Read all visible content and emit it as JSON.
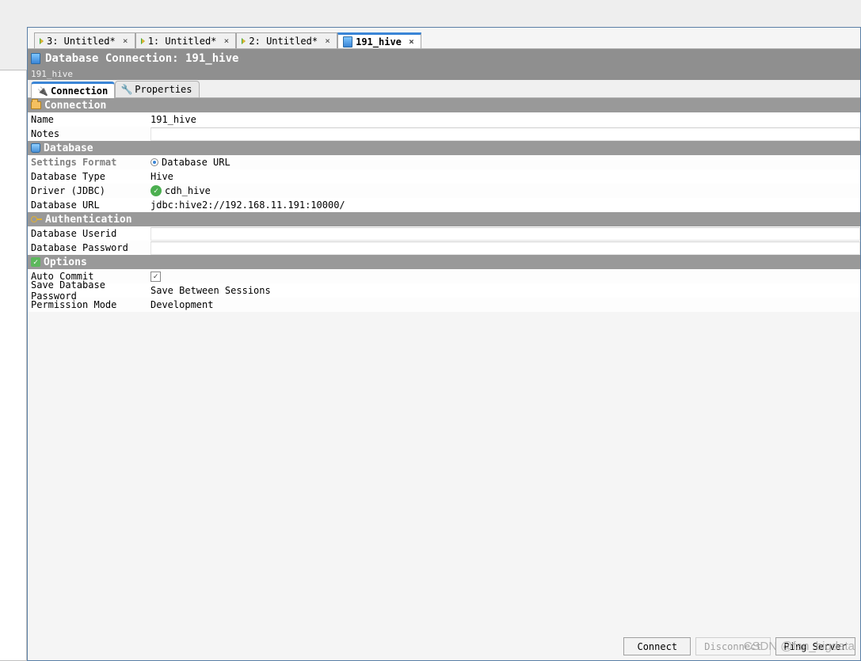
{
  "file_tabs": [
    {
      "label": "3: Untitled*",
      "active": false
    },
    {
      "label": "1: Untitled*",
      "active": false
    },
    {
      "label": "2: Untitled*",
      "active": false
    },
    {
      "label": "191_hive",
      "active": true
    }
  ],
  "title_bar": "Database Connection: 191_hive",
  "breadcrumb": "191_hive",
  "inner_tabs": {
    "connection": "Connection",
    "properties": "Properties"
  },
  "sections": {
    "connection": {
      "header": "Connection",
      "name_label": "Name",
      "name_value": "191_hive",
      "notes_label": "Notes"
    },
    "database": {
      "header": "Database",
      "settings_format_label": "Settings Format",
      "settings_format_value": "Database URL",
      "db_type_label": "Database Type",
      "db_type_value": "Hive",
      "driver_label": "Driver (JDBC)",
      "driver_value": "cdh_hive",
      "db_url_label": "Database URL",
      "db_url_value": "jdbc:hive2://192.168.11.191:10000/"
    },
    "auth": {
      "header": "Authentication",
      "userid_label": "Database Userid",
      "password_label": "Database Password"
    },
    "options": {
      "header": "Options",
      "auto_commit_label": "Auto Commit",
      "auto_commit_checked": true,
      "save_pw_label": "Save Database Password",
      "save_pw_value": "Save Between Sessions",
      "perm_mode_label": "Permission Mode",
      "perm_mode_value": "Development"
    }
  },
  "buttons": {
    "connect": "Connect",
    "disconnect": "Disconnect",
    "ping": "Ping Server"
  },
  "watermark": "CSDN @fan_bigdata"
}
